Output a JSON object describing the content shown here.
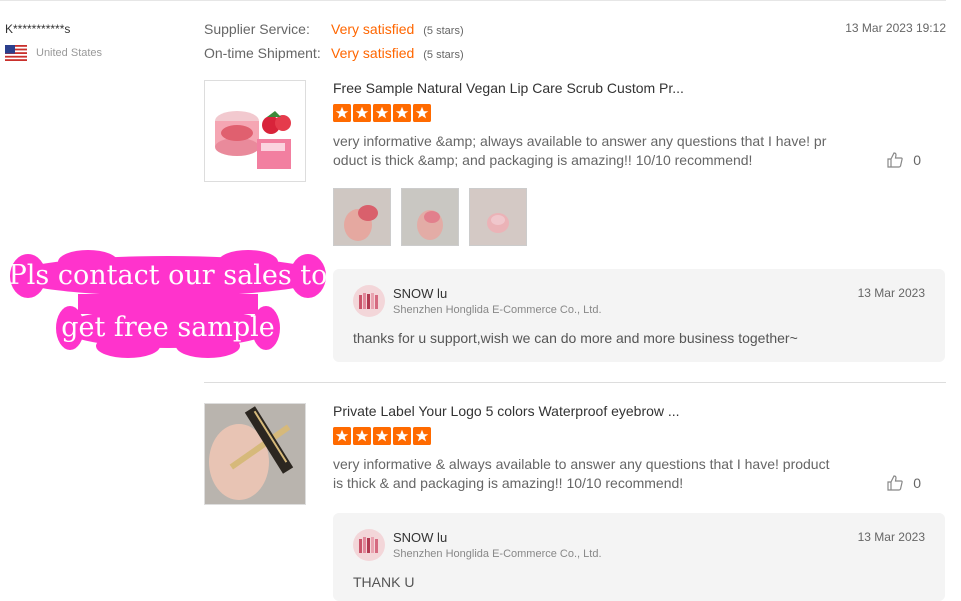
{
  "reviewer": {
    "name": "K***********s",
    "country": "United States",
    "flag_icon": "us-flag-icon"
  },
  "ratings": [
    {
      "label": "Supplier Service:",
      "value": "Very satisfied",
      "stars": "(5 stars)"
    },
    {
      "label": "On-time Shipment:",
      "value": "Very satisfied",
      "stars": "(5 stars)"
    }
  ],
  "timestamp": "13 Mar 2023 19:12",
  "reviews": [
    {
      "title": "Free Sample Natural Vegan Lip Care Scrub Custom Pr...",
      "rating": 5,
      "text": "very informative &amp; always available to answer any questions that I have! product is thick &amp; and packaging is amazing!! 10/10 recommend!",
      "likes": "0",
      "photo_count": 3,
      "reply": {
        "name": "SNOW lu",
        "company": "Shenzhen Honglida E-Commerce Co., Ltd.",
        "date": "13 Mar 2023",
        "text": "thanks for u support,wish we can do more and more business together~"
      }
    },
    {
      "title": "Private Label Your Logo 5 colors Waterproof eyebrow ...",
      "rating": 5,
      "text": "very informative & always available to answer any questions that I have! product is thick & and packaging is amazing!! 10/10 recommend!",
      "likes": "0",
      "reply": {
        "name": "SNOW lu",
        "company": "Shenzhen Honglida E-Commerce Co., Ltd.",
        "date": "13 Mar 2023",
        "text": "THANK U"
      }
    }
  ],
  "banner": {
    "line1": "Pls contact our sales to",
    "line2": "get free sample"
  },
  "colors": {
    "accent": "#ff6600",
    "banner": "#ff33cc",
    "star": "#ff6a00"
  },
  "icons": {
    "star": "star-icon",
    "like": "thumbs-up-icon"
  }
}
